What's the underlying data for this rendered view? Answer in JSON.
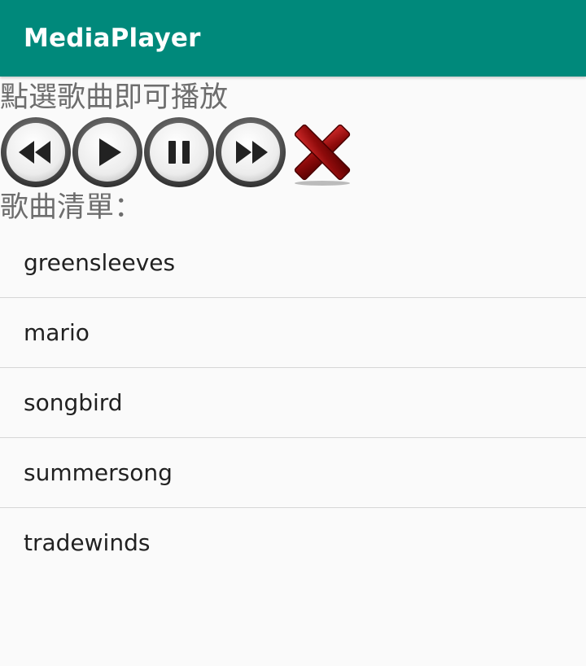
{
  "appbar": {
    "title": "MediaPlayer",
    "color": "#00897b"
  },
  "hint_text": "點選歌曲即可播放",
  "controls": [
    {
      "name": "rewind",
      "icon": "rewind-icon"
    },
    {
      "name": "play",
      "icon": "play-icon"
    },
    {
      "name": "pause",
      "icon": "pause-icon"
    },
    {
      "name": "fast-forward",
      "icon": "fast-forward-icon"
    },
    {
      "name": "close",
      "icon": "close-x-icon"
    }
  ],
  "list_label": "歌曲清單：",
  "songs": [
    {
      "label": "greensleeves"
    },
    {
      "label": "mario"
    },
    {
      "label": "songbird"
    },
    {
      "label": "summersong"
    },
    {
      "label": "tradewinds"
    }
  ]
}
